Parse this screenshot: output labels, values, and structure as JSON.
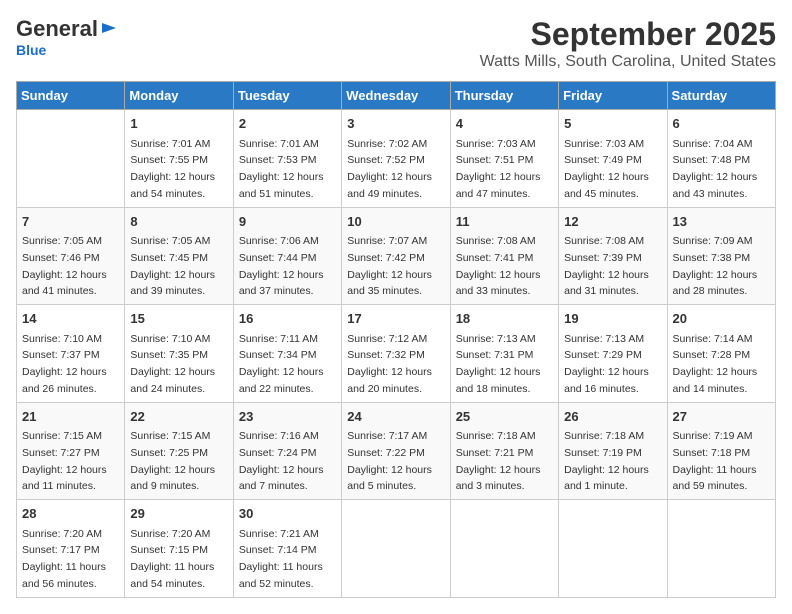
{
  "header": {
    "logo_general": "General",
    "logo_blue": "Blue",
    "title": "September 2025",
    "subtitle": "Watts Mills, South Carolina, United States"
  },
  "days_of_week": [
    "Sunday",
    "Monday",
    "Tuesday",
    "Wednesday",
    "Thursday",
    "Friday",
    "Saturday"
  ],
  "weeks": [
    [
      {
        "day": "",
        "info": ""
      },
      {
        "day": "1",
        "info": "Sunrise: 7:01 AM\nSunset: 7:55 PM\nDaylight: 12 hours\nand 54 minutes."
      },
      {
        "day": "2",
        "info": "Sunrise: 7:01 AM\nSunset: 7:53 PM\nDaylight: 12 hours\nand 51 minutes."
      },
      {
        "day": "3",
        "info": "Sunrise: 7:02 AM\nSunset: 7:52 PM\nDaylight: 12 hours\nand 49 minutes."
      },
      {
        "day": "4",
        "info": "Sunrise: 7:03 AM\nSunset: 7:51 PM\nDaylight: 12 hours\nand 47 minutes."
      },
      {
        "day": "5",
        "info": "Sunrise: 7:03 AM\nSunset: 7:49 PM\nDaylight: 12 hours\nand 45 minutes."
      },
      {
        "day": "6",
        "info": "Sunrise: 7:04 AM\nSunset: 7:48 PM\nDaylight: 12 hours\nand 43 minutes."
      }
    ],
    [
      {
        "day": "7",
        "info": "Sunrise: 7:05 AM\nSunset: 7:46 PM\nDaylight: 12 hours\nand 41 minutes."
      },
      {
        "day": "8",
        "info": "Sunrise: 7:05 AM\nSunset: 7:45 PM\nDaylight: 12 hours\nand 39 minutes."
      },
      {
        "day": "9",
        "info": "Sunrise: 7:06 AM\nSunset: 7:44 PM\nDaylight: 12 hours\nand 37 minutes."
      },
      {
        "day": "10",
        "info": "Sunrise: 7:07 AM\nSunset: 7:42 PM\nDaylight: 12 hours\nand 35 minutes."
      },
      {
        "day": "11",
        "info": "Sunrise: 7:08 AM\nSunset: 7:41 PM\nDaylight: 12 hours\nand 33 minutes."
      },
      {
        "day": "12",
        "info": "Sunrise: 7:08 AM\nSunset: 7:39 PM\nDaylight: 12 hours\nand 31 minutes."
      },
      {
        "day": "13",
        "info": "Sunrise: 7:09 AM\nSunset: 7:38 PM\nDaylight: 12 hours\nand 28 minutes."
      }
    ],
    [
      {
        "day": "14",
        "info": "Sunrise: 7:10 AM\nSunset: 7:37 PM\nDaylight: 12 hours\nand 26 minutes."
      },
      {
        "day": "15",
        "info": "Sunrise: 7:10 AM\nSunset: 7:35 PM\nDaylight: 12 hours\nand 24 minutes."
      },
      {
        "day": "16",
        "info": "Sunrise: 7:11 AM\nSunset: 7:34 PM\nDaylight: 12 hours\nand 22 minutes."
      },
      {
        "day": "17",
        "info": "Sunrise: 7:12 AM\nSunset: 7:32 PM\nDaylight: 12 hours\nand 20 minutes."
      },
      {
        "day": "18",
        "info": "Sunrise: 7:13 AM\nSunset: 7:31 PM\nDaylight: 12 hours\nand 18 minutes."
      },
      {
        "day": "19",
        "info": "Sunrise: 7:13 AM\nSunset: 7:29 PM\nDaylight: 12 hours\nand 16 minutes."
      },
      {
        "day": "20",
        "info": "Sunrise: 7:14 AM\nSunset: 7:28 PM\nDaylight: 12 hours\nand 14 minutes."
      }
    ],
    [
      {
        "day": "21",
        "info": "Sunrise: 7:15 AM\nSunset: 7:27 PM\nDaylight: 12 hours\nand 11 minutes."
      },
      {
        "day": "22",
        "info": "Sunrise: 7:15 AM\nSunset: 7:25 PM\nDaylight: 12 hours\nand 9 minutes."
      },
      {
        "day": "23",
        "info": "Sunrise: 7:16 AM\nSunset: 7:24 PM\nDaylight: 12 hours\nand 7 minutes."
      },
      {
        "day": "24",
        "info": "Sunrise: 7:17 AM\nSunset: 7:22 PM\nDaylight: 12 hours\nand 5 minutes."
      },
      {
        "day": "25",
        "info": "Sunrise: 7:18 AM\nSunset: 7:21 PM\nDaylight: 12 hours\nand 3 minutes."
      },
      {
        "day": "26",
        "info": "Sunrise: 7:18 AM\nSunset: 7:19 PM\nDaylight: 12 hours\nand 1 minute."
      },
      {
        "day": "27",
        "info": "Sunrise: 7:19 AM\nSunset: 7:18 PM\nDaylight: 11 hours\nand 59 minutes."
      }
    ],
    [
      {
        "day": "28",
        "info": "Sunrise: 7:20 AM\nSunset: 7:17 PM\nDaylight: 11 hours\nand 56 minutes."
      },
      {
        "day": "29",
        "info": "Sunrise: 7:20 AM\nSunset: 7:15 PM\nDaylight: 11 hours\nand 54 minutes."
      },
      {
        "day": "30",
        "info": "Sunrise: 7:21 AM\nSunset: 7:14 PM\nDaylight: 11 hours\nand 52 minutes."
      },
      {
        "day": "",
        "info": ""
      },
      {
        "day": "",
        "info": ""
      },
      {
        "day": "",
        "info": ""
      },
      {
        "day": "",
        "info": ""
      }
    ]
  ]
}
